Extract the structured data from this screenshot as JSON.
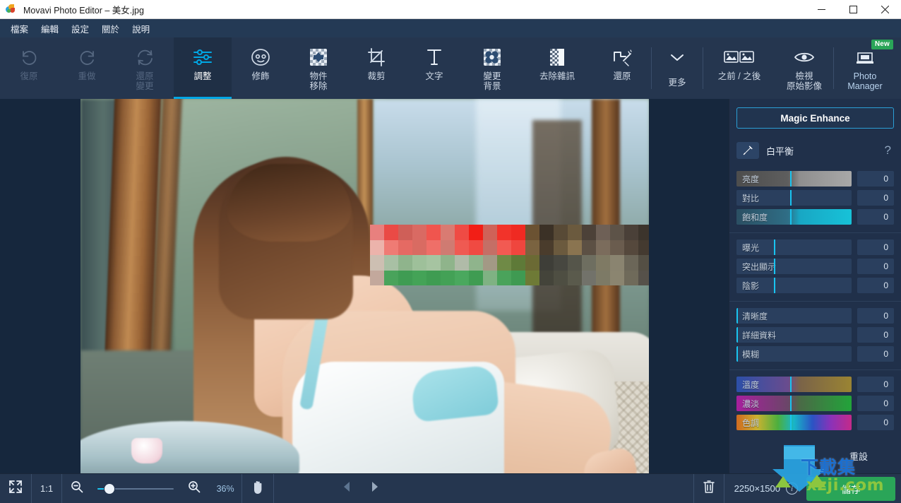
{
  "window": {
    "title": "Movavi Photo Editor – 美女.jpg",
    "logo_icon": "movavi-logo-icon",
    "controls": [
      {
        "name": "minimize",
        "glyph": "—"
      },
      {
        "name": "maximize",
        "glyph": "▢"
      },
      {
        "name": "close",
        "glyph": "✕"
      }
    ]
  },
  "menu": {
    "items": [
      {
        "label": "檔案"
      },
      {
        "label": "編輯"
      },
      {
        "label": "設定"
      },
      {
        "label": "關於"
      },
      {
        "label": "說明"
      }
    ]
  },
  "toolbar": {
    "history": [
      {
        "label": "復原",
        "icon": "undo-icon",
        "enabled": false
      },
      {
        "label": "重做",
        "icon": "redo-icon",
        "enabled": false
      },
      {
        "label": "還原\n變更",
        "icon": "reset-changes-icon",
        "enabled": false
      }
    ],
    "tools": [
      {
        "label": "調整",
        "icon": "adjust-sliders-icon",
        "active": true
      },
      {
        "label": "修飾",
        "icon": "retouch-face-icon",
        "active": false
      },
      {
        "label": "物件\n移除",
        "icon": "object-removal-icon",
        "active": false
      },
      {
        "label": "裁剪",
        "icon": "crop-icon",
        "active": false
      },
      {
        "label": "文字",
        "icon": "text-icon",
        "active": false
      },
      {
        "label": "變更\n背景",
        "icon": "change-background-icon",
        "active": false
      },
      {
        "label": "去除雜訊",
        "icon": "denoise-icon",
        "active": false
      },
      {
        "label": "還原",
        "icon": "restore-magic-icon",
        "active": false
      }
    ],
    "more": {
      "label": "更多",
      "icon": "chevron-down-icon"
    },
    "view": [
      {
        "label": "之前 / 之後",
        "icon": "before-after-icon"
      },
      {
        "label": "檢視\n原始影像",
        "icon": "eye-icon"
      }
    ],
    "photo_manager": {
      "label": "Photo\nManager",
      "icon": "photo-manager-icon",
      "badge": "New"
    }
  },
  "panel": {
    "magic_enhance": "Magic Enhance",
    "white_balance": {
      "label": "白平衡",
      "icon": "eyedropper-icon",
      "help": "?"
    },
    "slider_groups": [
      {
        "group": "tone",
        "sliders": [
          {
            "label": "亮度",
            "value": "0",
            "handle_pct": 47,
            "track": "brightness"
          },
          {
            "label": "對比",
            "value": "0",
            "handle_pct": 47,
            "track": "plain"
          },
          {
            "label": "飽和度",
            "value": "0",
            "handle_pct": 47,
            "track": "saturation"
          }
        ]
      },
      {
        "group": "light",
        "sliders": [
          {
            "label": "曝光",
            "value": "0",
            "handle_pct": 33,
            "track": "plain"
          },
          {
            "label": "突出顯示",
            "value": "0",
            "handle_pct": 33,
            "track": "plain"
          },
          {
            "label": "陰影",
            "value": "0",
            "handle_pct": 33,
            "track": "plain"
          }
        ]
      },
      {
        "group": "detail",
        "sliders": [
          {
            "label": "清晰度",
            "value": "0",
            "handle_pct": 0,
            "track": "plain"
          },
          {
            "label": "詳細資料",
            "value": "0",
            "handle_pct": 0,
            "track": "plain"
          },
          {
            "label": "模糊",
            "value": "0",
            "handle_pct": 0,
            "track": "plain"
          }
        ]
      },
      {
        "group": "color",
        "sliders": [
          {
            "label": "溫度",
            "value": "0",
            "handle_pct": 47,
            "track": "temperature"
          },
          {
            "label": "濃淡",
            "value": "0",
            "handle_pct": 47,
            "track": "tint"
          },
          {
            "label": "色調",
            "value": "0",
            "handle_pct": 47,
            "track": "hue"
          }
        ]
      }
    ],
    "reset_button": "重設"
  },
  "bottom": {
    "fit_icon": "fit-to-screen-icon",
    "ratio": "1:1",
    "zoom_out_icon": "zoom-out-icon",
    "zoom_in_icon": "zoom-in-icon",
    "zoom_value": "36%",
    "zoom_slider_pct": 12,
    "hand_icon": "hand-tool-icon",
    "prev_icon": "previous-image-icon",
    "next_icon": "next-image-icon",
    "delete_icon": "trash-icon",
    "dimensions": "2250×1500",
    "info_icon": "info-icon",
    "save_label": "儲存"
  },
  "watermark": {
    "title": "下載集",
    "site": "xzji.com",
    "arrow_icon": "download-arrow-icon"
  },
  "colors": {
    "accent": "#00a7e5",
    "handle": "#19c4f0",
    "panel_bg": "#20304a",
    "toolbar_bg": "#25364f",
    "menu_bg": "#243a55",
    "canvas_bg": "#16273d",
    "save_green": "#2aa558",
    "badge_green": "#2aa558",
    "wm_blue": "#1b6fd0",
    "wm_green": "#8cc63f"
  }
}
